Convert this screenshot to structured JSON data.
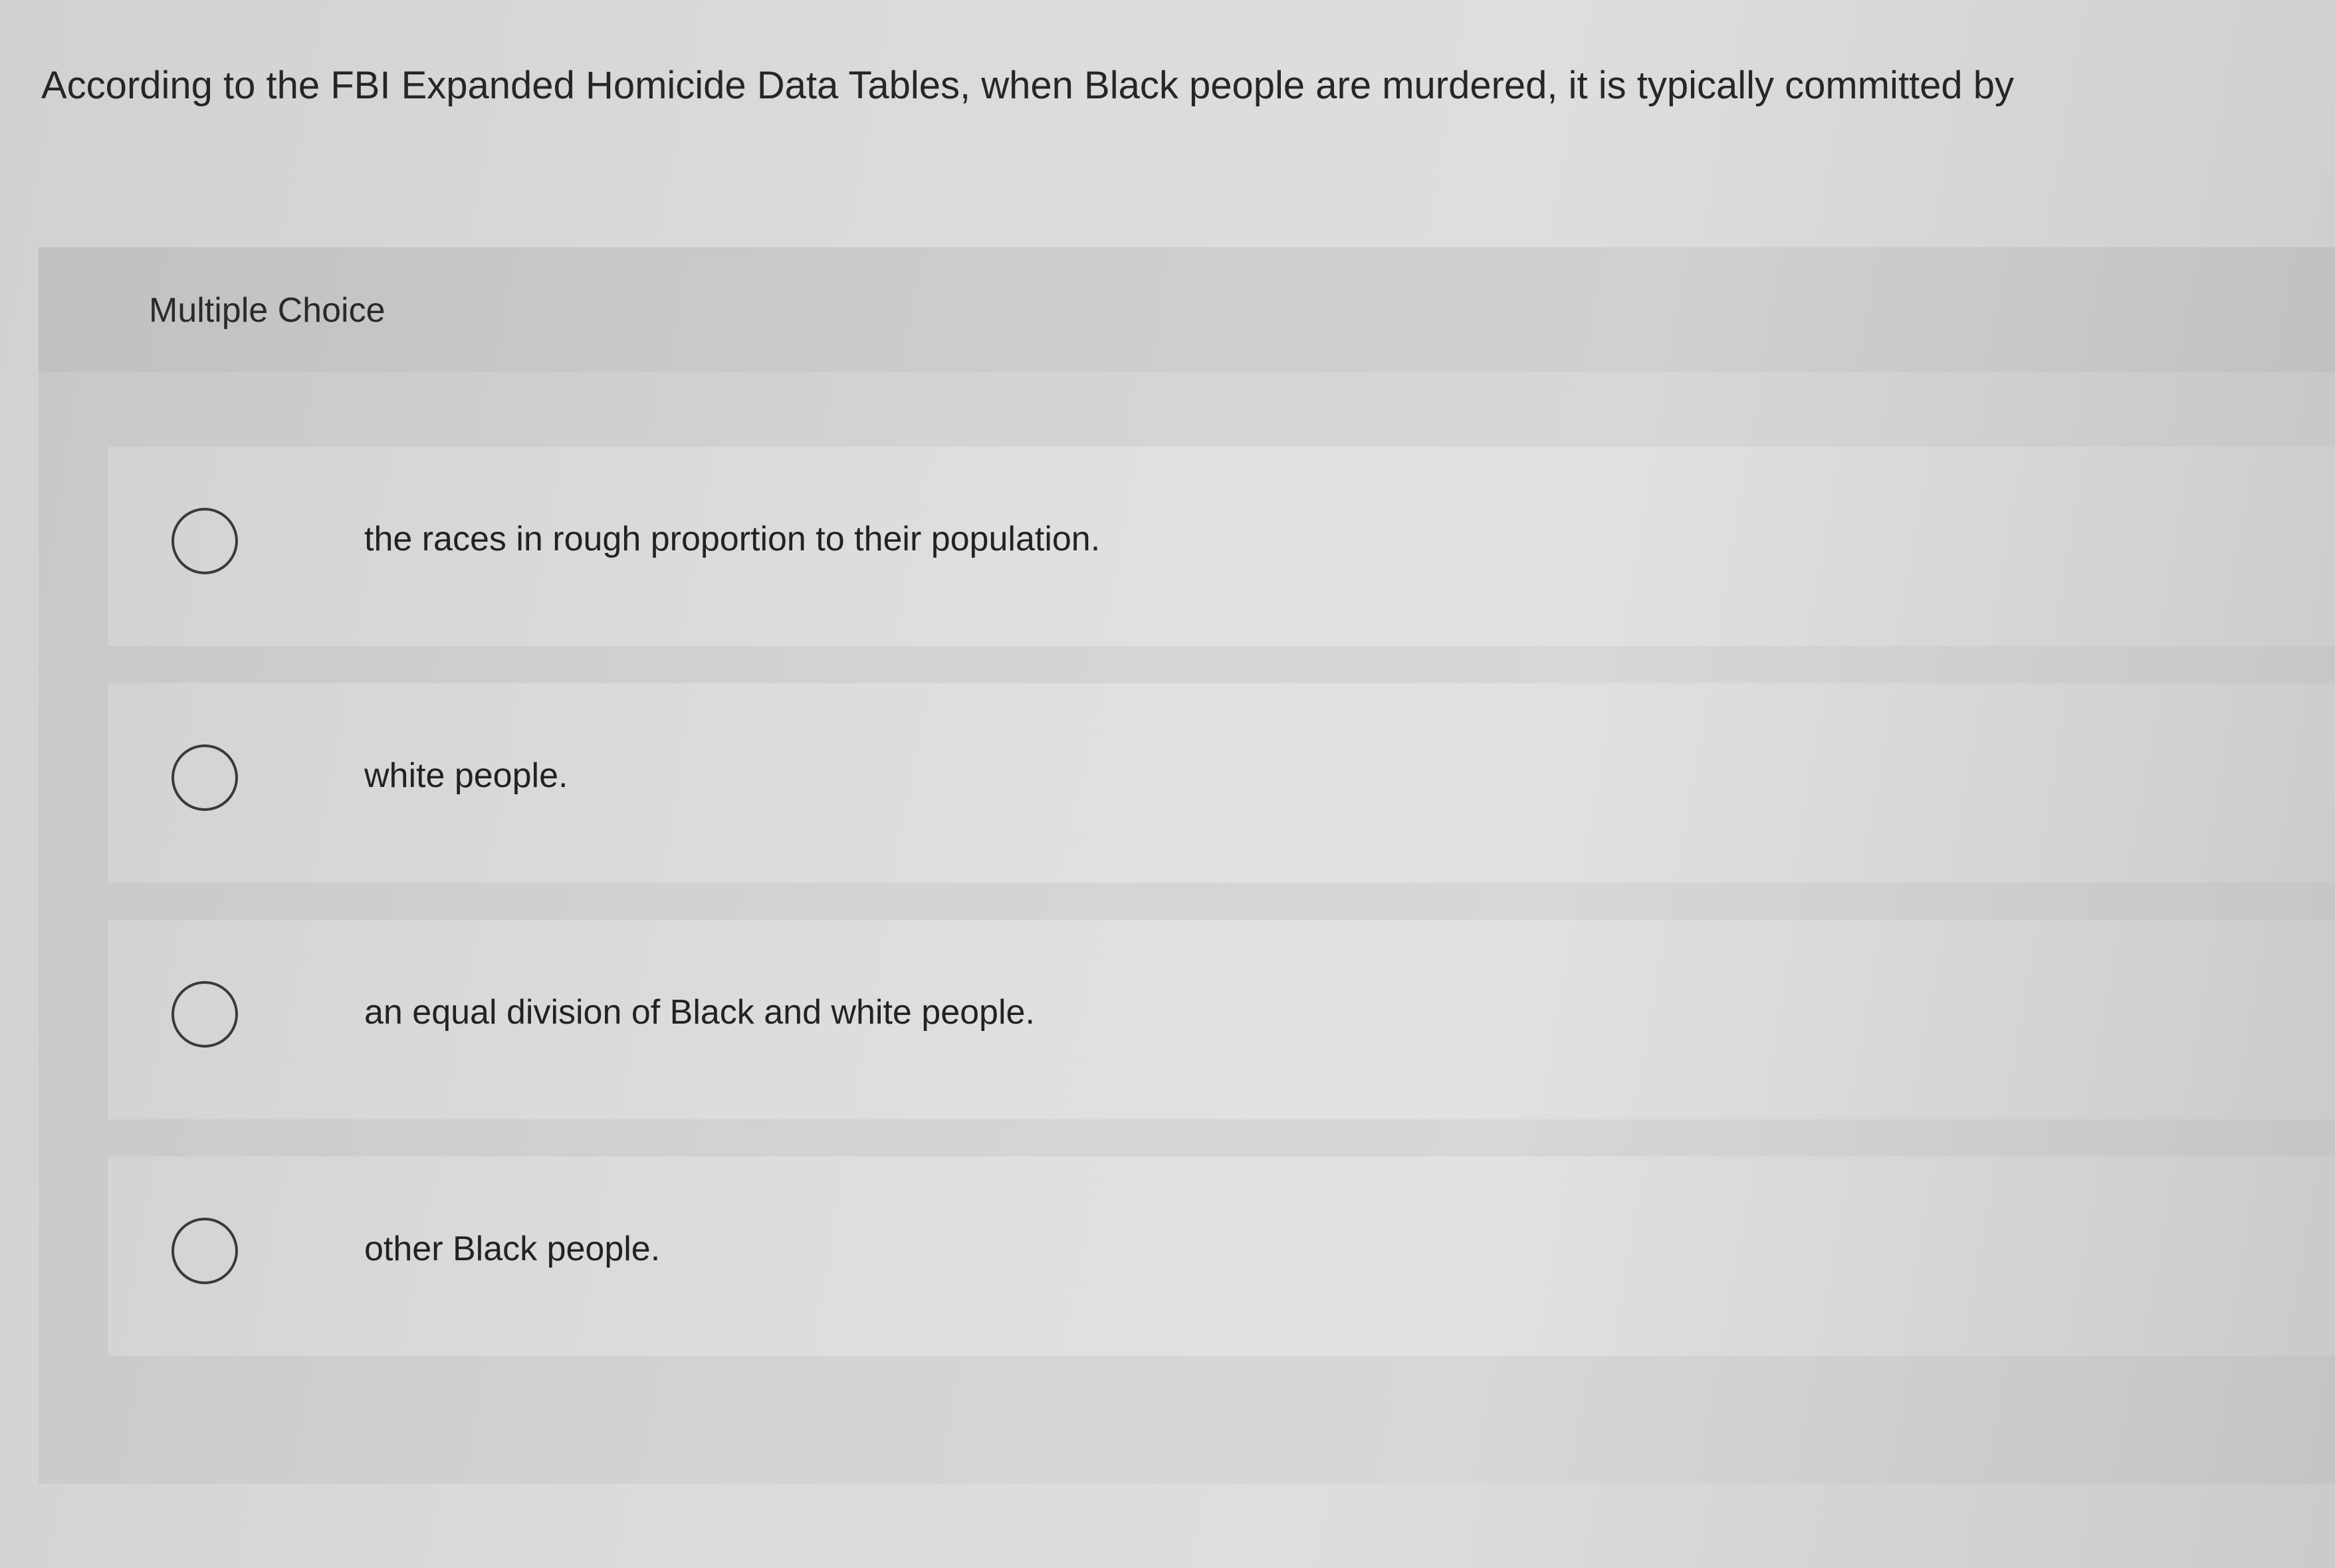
{
  "question": {
    "text": "According to the FBI Expanded Homicide Data Tables, when Black people are murdered, it is typically committed by"
  },
  "panel": {
    "type_label": "Multiple Choice"
  },
  "choices": [
    {
      "label": "the races in rough proportion to their population.",
      "selected": false
    },
    {
      "label": "white people.",
      "selected": false
    },
    {
      "label": "an equal division of Black and white people.",
      "selected": false
    },
    {
      "label": "other Black people.",
      "selected": false
    }
  ],
  "colors": {
    "background": "#d9dbdc",
    "panel": "#d2d4d5",
    "text": "#262626",
    "radio_border": "#3a3a3a"
  }
}
